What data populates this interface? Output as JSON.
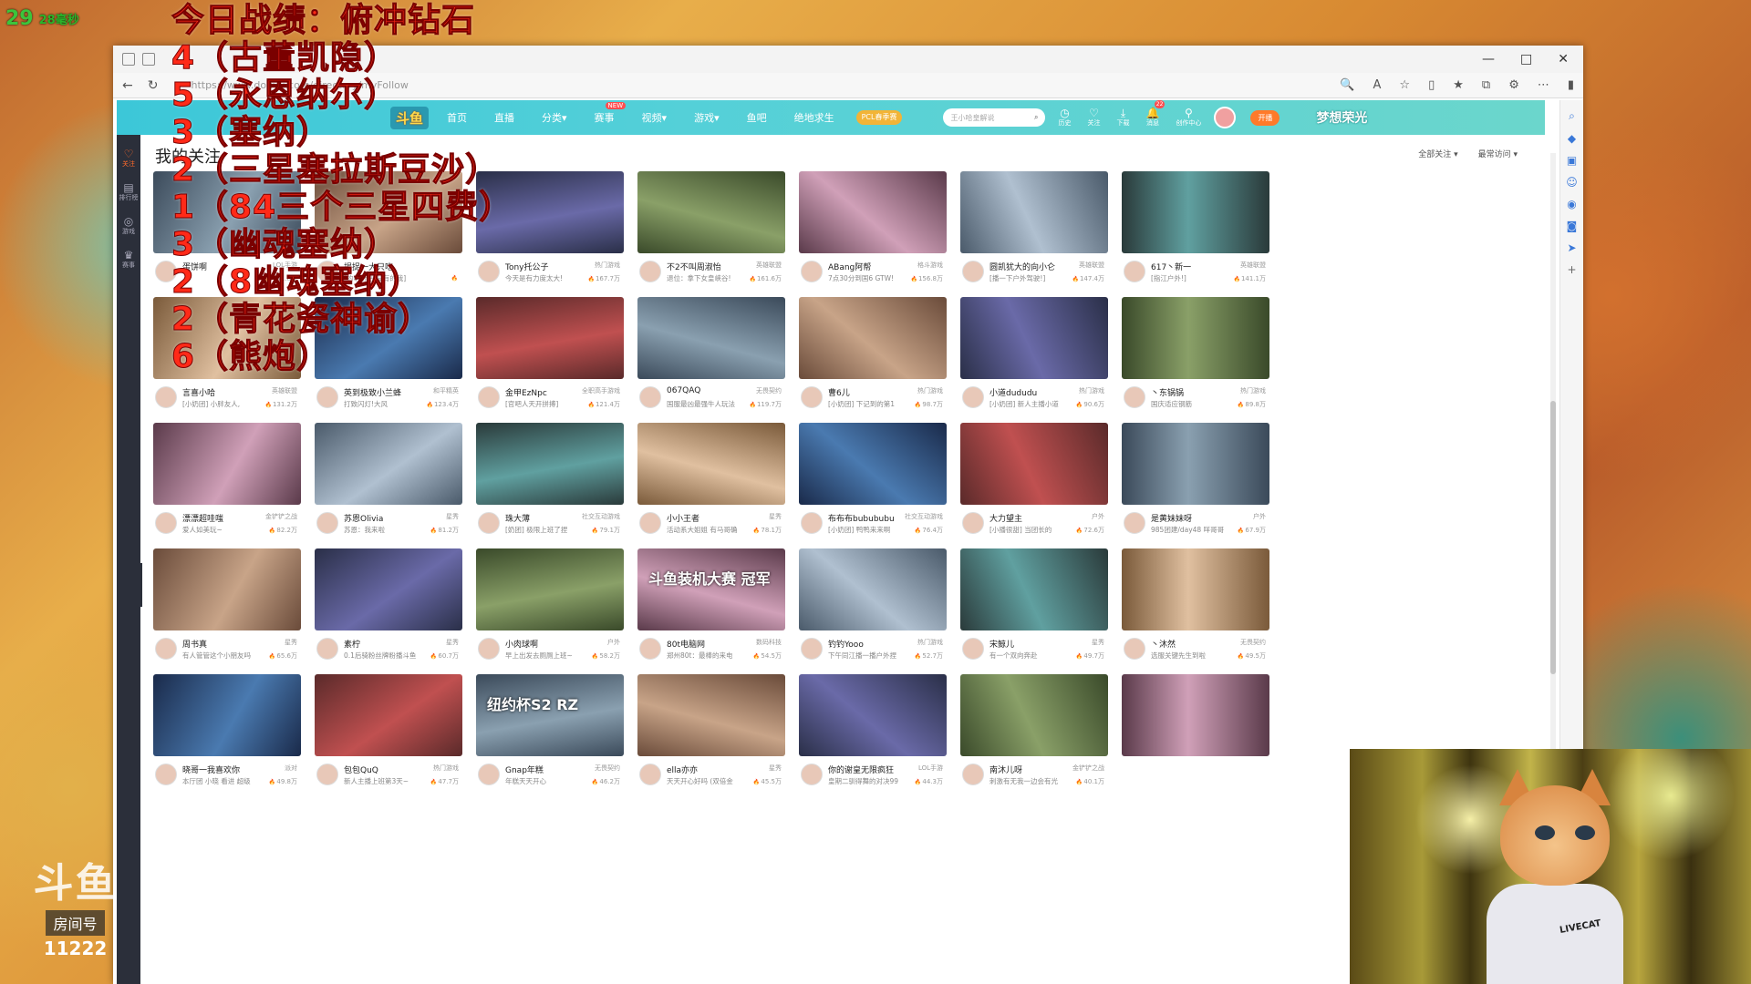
{
  "overlay": {
    "counter_num": "29",
    "counter_seconds": "28毫秒",
    "lines": [
      "今日战绩：俯冲钻石",
      "4（古董凯隐）",
      "5（永恩纳尔）",
      "3（塞纳）",
      "2（三星塞拉斯豆沙）",
      "1（84三个三星四费）",
      "3（幽魂塞纳）",
      "2（8幽魂塞纳）",
      "2（青花瓷神谕）",
      "6（熊炮）"
    ]
  },
  "room": {
    "logo": "斗鱼",
    "label": "房间号",
    "number": "11222"
  },
  "browser": {
    "url": "https://www.douyu.com/directory/myFollow",
    "window_controls": [
      "—",
      "□",
      "✕"
    ]
  },
  "nav": {
    "logo": "斗鱼",
    "items": [
      {
        "label": "首页"
      },
      {
        "label": "直播"
      },
      {
        "label": "分类",
        "dropdown": true
      },
      {
        "label": "赛事",
        "badge": "NEW"
      },
      {
        "label": "视频",
        "dropdown": true
      },
      {
        "label": "游戏",
        "dropdown": true
      },
      {
        "label": "鱼吧"
      },
      {
        "label": "绝地求生"
      }
    ],
    "promo": "PCL春季赛",
    "search_placeholder": "王小哈皇解说",
    "icons": [
      {
        "label": "历史",
        "icon": "clock-icon"
      },
      {
        "label": "关注",
        "icon": "heart-icon"
      },
      {
        "label": "下载",
        "icon": "download-icon"
      },
      {
        "label": "消息",
        "icon": "bell-icon",
        "badge": "22"
      },
      {
        "label": "创作中心",
        "icon": "pin-icon"
      }
    ],
    "live_button": "开播",
    "brand": "梦想荣光"
  },
  "sidebar": {
    "items": [
      {
        "label": "关注",
        "icon": "heart-icon",
        "active": true
      },
      {
        "label": "排行榜",
        "icon": "list-icon"
      },
      {
        "label": "游戏",
        "icon": "controller-icon"
      },
      {
        "label": "赛事",
        "icon": "trophy-icon"
      }
    ]
  },
  "page": {
    "title": "我的关注",
    "filters": [
      "全部关注",
      "最常访问"
    ]
  },
  "rows": [
    [
      {
        "name": "蛋饼啊",
        "desc": "",
        "cat": "LOL手游",
        "heat": "141.8万"
      },
      {
        "name": "揭捉一大只吃",
        "desc": "[的听听吧,没有的我]",
        "cat": "",
        "heat": ""
      },
      {
        "name": "Tony托公子",
        "desc": "今天是有力度太大!",
        "cat": "热门游戏",
        "heat": "167.7万"
      },
      {
        "name": "不2不叫周淑怡",
        "desc": "退位：拿下女皇峡谷!",
        "cat": "英雄联盟",
        "heat": "161.6万"
      },
      {
        "name": "ABang阿帮",
        "desc": "7点30分到国6 GTW!",
        "cat": "格斗游戏",
        "heat": "156.8万"
      },
      {
        "name": "圆凯犹大的向小仑",
        "desc": "[播一下户外驾驶!]",
        "cat": "英雄联盟",
        "heat": "147.4万"
      },
      {
        "name": "617丶新一",
        "desc": "[指江户外!]",
        "cat": "英雄联盟",
        "heat": "141.1万"
      }
    ],
    [
      {
        "name": "言喜小哈",
        "desc": "[小奶团] 小胖友人,",
        "cat": "英雄联盟",
        "heat": "131.2万"
      },
      {
        "name": "英到极致小兰蜂",
        "desc": "打致闪灯!大风",
        "cat": "和平精英",
        "heat": "123.4万"
      },
      {
        "name": "金甲EzNpc",
        "desc": "[官吧人天开拼搏]",
        "cat": "全职高手游戏",
        "heat": "121.4万"
      },
      {
        "name": "067QAQ",
        "desc": "国服最凶最强牛人玩法",
        "cat": "无畏契约",
        "heat": "119.7万"
      },
      {
        "name": "曹6儿",
        "desc": "[小奶团] 下记到的第1",
        "cat": "热门游戏",
        "heat": "98.7万"
      },
      {
        "name": "小道dududu",
        "desc": "[小奶团] 新人主播小道",
        "cat": "热门游戏",
        "heat": "90.6万"
      },
      {
        "name": "丶东锅锅",
        "desc": "国庆适应钢筋",
        "cat": "热门游戏",
        "heat": "89.8万"
      }
    ],
    [
      {
        "name": "漂漂超哇嗤",
        "desc": "爱人如美玩~",
        "cat": "金铲铲之战",
        "heat": "82.2万"
      },
      {
        "name": "苏恩Olivia",
        "desc": "苏恩：我来啦",
        "cat": "星秀",
        "heat": "81.2万"
      },
      {
        "name": "珠大薄",
        "desc": "[奶团] 极限上班了捏",
        "cat": "社交互动游戏",
        "heat": "79.1万"
      },
      {
        "name": "小小王者",
        "desc": "活动系大姐姐 有马哥确",
        "cat": "星秀",
        "heat": "78.1万"
      },
      {
        "name": "布布布bubububu",
        "desc": "[小奶团] 鸭鸭来来啊",
        "cat": "社交互动游戏",
        "heat": "76.4万"
      },
      {
        "name": "大力望主",
        "desc": "[小播很甜] 当团长的",
        "cat": "户外",
        "heat": "72.6万"
      },
      {
        "name": "是黄妹妹呀",
        "desc": "985团建/day48 咩哥哥",
        "cat": "户外",
        "heat": "67.9万"
      }
    ],
    [
      {
        "name": "周书真",
        "desc": "有人管管这个小朋友吗",
        "cat": "星秀",
        "heat": "65.6万"
      },
      {
        "name": "素柠",
        "desc": "0.1后骑粉丝牌粉播斗鱼",
        "cat": "星秀",
        "heat": "60.7万"
      },
      {
        "name": "小肉球啊",
        "desc": "早上出发去厕厕上班~",
        "cat": "户外",
        "heat": "58.2万"
      },
      {
        "name": "80t电脑网",
        "desc": "郑州80t：最棒的来电",
        "cat": "数码科技",
        "heat": "54.5万",
        "caption": "斗鱼装机大赛 冠军"
      },
      {
        "name": "钓钓Yooo",
        "desc": "下午同江播一播户外捏",
        "cat": "热门游戏",
        "heat": "52.7万"
      },
      {
        "name": "宋鲸儿",
        "desc": "有一个双向奔赴",
        "cat": "星秀",
        "heat": "49.7万"
      },
      {
        "name": "丶沐然",
        "desc": "选服关键先生到啦",
        "cat": "无畏契约",
        "heat": "49.5万"
      }
    ],
    [
      {
        "name": "晓哥一我喜欢你",
        "desc": "本厅团 小晓 看进 超级",
        "cat": "派对",
        "heat": "49.8万"
      },
      {
        "name": "包包QuQ",
        "desc": "新人主播上班第3天~",
        "cat": "热门游戏",
        "heat": "47.7万"
      },
      {
        "name": "Gnap年糕",
        "desc": "年糕天天开心",
        "cat": "无畏契约",
        "heat": "46.2万",
        "caption": "纽约杯S2 RZ"
      },
      {
        "name": "ella亦亦",
        "desc": "天天开心好吗 (双倍金",
        "cat": "星秀",
        "heat": "45.5万"
      },
      {
        "name": "你的谢皇无限疯狂",
        "desc": "皇期二驯得舞的对决99",
        "cat": "LOL手游",
        "heat": "44.3万"
      },
      {
        "name": "南沐儿呀",
        "desc": "刺激有无我一边会有光",
        "cat": "金铲铲之战",
        "heat": "40.1万"
      },
      {
        "name": "",
        "desc": "",
        "cat": "",
        "heat": ""
      }
    ]
  ],
  "webcam": {
    "shirt_text": "LIVECAT"
  }
}
